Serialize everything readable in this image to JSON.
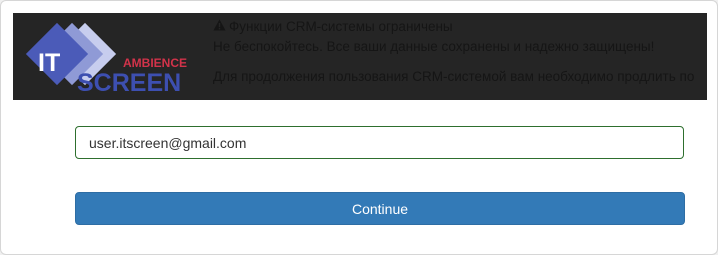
{
  "logo": {
    "it_text": "IT",
    "ambience_text": "AMBIENCE",
    "screen_text": "SCREEN",
    "colors": {
      "diamond_front": "#4b5bb8",
      "diamond_mid": "#8f9ad6",
      "diamond_back": "#c7cdee",
      "ambience": "#d2334a",
      "screen": "#3d4fb0"
    }
  },
  "notice": {
    "icon": "warning-triangle-icon",
    "title": "Функции CRM-системы ограничены",
    "line1": "Не беспокойтесь. Все ваши данные сохранены и надежно защищены!",
    "line2": "Для продолжения пользования CRM-системой вам необходимо продлить по"
  },
  "form": {
    "email_value": "user.itscreen@gmail.com",
    "continue_label": "Continue"
  },
  "colors": {
    "banner_bg": "#252525",
    "input_border": "#2e6f2e",
    "button_bg": "#337ab7"
  }
}
